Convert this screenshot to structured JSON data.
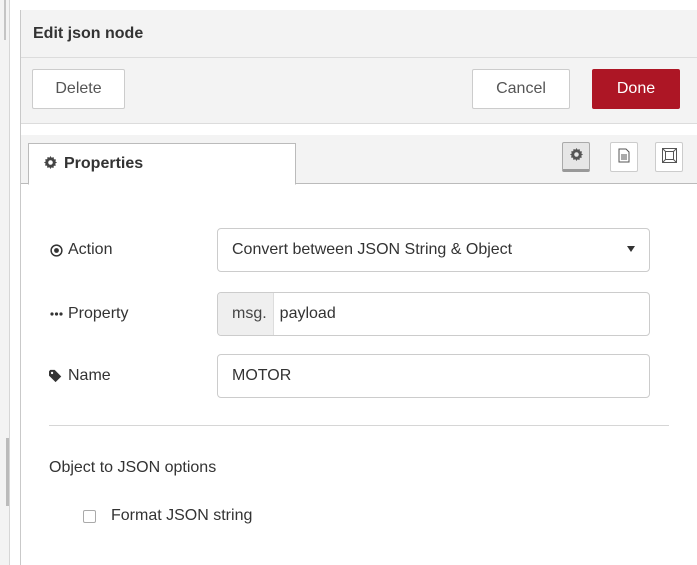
{
  "header": {
    "title": "Edit json node"
  },
  "toolbar": {
    "delete_label": "Delete",
    "cancel_label": "Cancel",
    "done_label": "Done"
  },
  "tabs": [
    {
      "label": "Properties",
      "icon": "gear-icon",
      "active": true
    }
  ],
  "tab_buttons": [
    {
      "icon": "gear-icon",
      "active": true
    },
    {
      "icon": "document-icon",
      "active": false
    },
    {
      "icon": "frame-icon",
      "active": false
    }
  ],
  "form": {
    "action": {
      "label": "Action",
      "icon": "radio-dot-icon",
      "value": "Convert between JSON String & Object"
    },
    "property": {
      "label": "Property",
      "icon": "ellipsis-icon",
      "type_prefix": "msg.",
      "value": "payload"
    },
    "name": {
      "label": "Name",
      "icon": "tag-icon",
      "value": "MOTOR"
    },
    "options_section": "Object to JSON options",
    "format_json": {
      "label": "Format JSON string",
      "checked": false
    }
  },
  "colors": {
    "accent": "#ad1625",
    "toolbar_bg": "#f3f3f3",
    "border": "#cccccc"
  }
}
